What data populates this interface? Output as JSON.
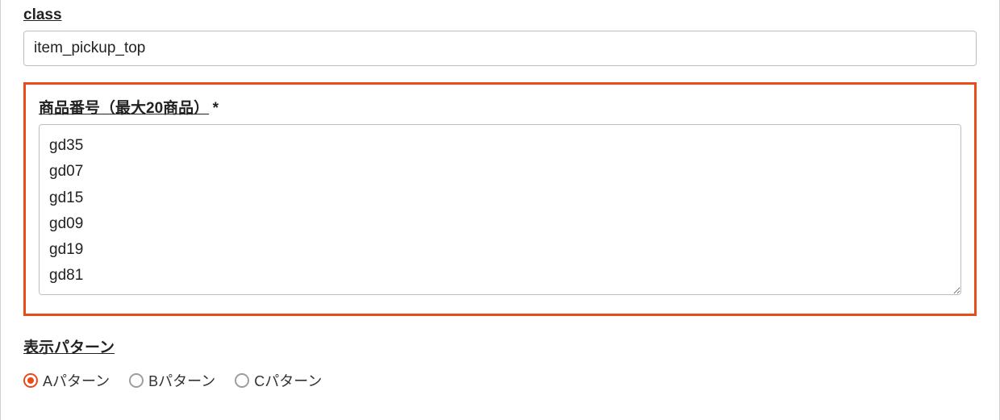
{
  "fields": {
    "class": {
      "label": "class",
      "value": "item_pickup_top"
    },
    "product_numbers": {
      "label": "商品番号（最大20商品）",
      "required_mark": "*",
      "value": "gd35\ngd07\ngd15\ngd09\ngd19\ngd81"
    },
    "display_pattern": {
      "label": "表示パターン",
      "options": [
        {
          "label": "Aパターン",
          "selected": true
        },
        {
          "label": "Bパターン",
          "selected": false
        },
        {
          "label": "Cパターン",
          "selected": false
        }
      ]
    }
  }
}
